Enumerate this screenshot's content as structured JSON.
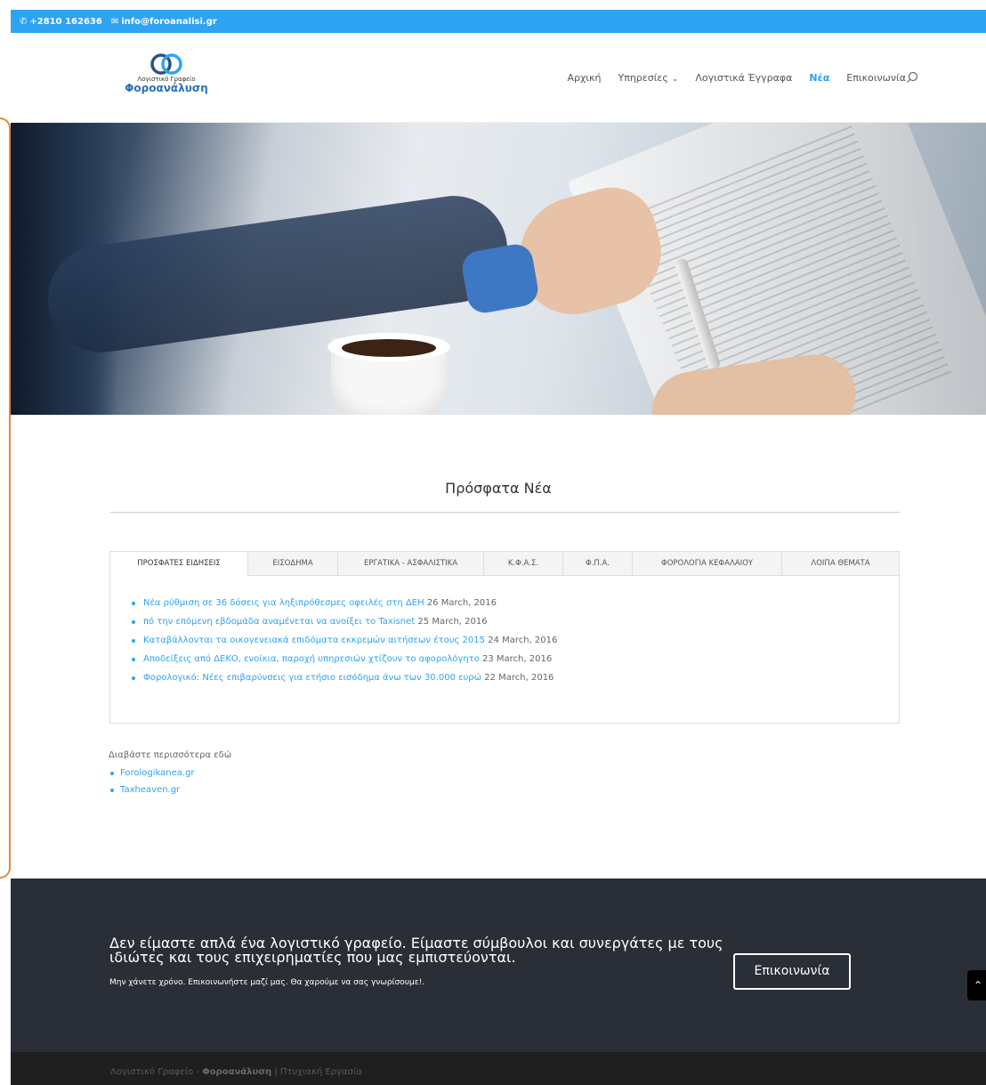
{
  "topbar": {
    "phone": "+2810 162636",
    "email": "info@foroanalisi.gr"
  },
  "logo": {
    "line1": "Λογιστικό Γραφείο",
    "line2": "Φοροανάλυση"
  },
  "nav": {
    "items": [
      {
        "label": "Αρχική"
      },
      {
        "label": "Υπηρεσίες"
      },
      {
        "label": "Λογιστικά Έγγραφα"
      },
      {
        "label": "Νέα"
      },
      {
        "label": "Επικοινωνία"
      }
    ]
  },
  "main": {
    "title": "Πρόσφατα Νέα",
    "tabs": [
      {
        "label": "ΠΡΟΣΦΑΤΕΣ ΕΙΔΗΣΕΙΣ"
      },
      {
        "label": "ΕΙΣΟΔΗΜΑ"
      },
      {
        "label": "ΕΡΓΑΤΙΚΑ - ΑΣΦΑΛΙΣΤΙΚΑ"
      },
      {
        "label": "Κ.Φ.Α.Σ."
      },
      {
        "label": "Φ.Π.Α."
      },
      {
        "label": "ΦΟΡΟΛΟΓΙΑ ΚΕΦΑΛΑΙΟΥ"
      },
      {
        "label": "ΛΟΙΠΑ ΘΕΜΑΤΑ"
      }
    ],
    "news": [
      {
        "title": "Νέα ρύθμιση σε 36 δόσεις για ληξιπρόθεσμες οφειλές στη ΔΕΗ",
        "date": "26 March, 2016"
      },
      {
        "title": "πό την επόμενη εβδομάδα αναμένεται να ανοίξει το Taxisnet",
        "date": "25 March, 2016"
      },
      {
        "title": "Καταβάλλονται τα οικογενειακά επιδόματα εκκρεμών αιτήσεων έτους 2015",
        "date": "24 March, 2016"
      },
      {
        "title": "Αποδείξεις από ΔΕΚΟ, ενοίκια, παροχή υπηρεσιών χτίζουν το αφορολόγητο",
        "date": "23 March, 2016"
      },
      {
        "title": "Φορολογικό: Νέες επιβαρύνσεις για ετήσιο εισόδημα άνω των 30.000 ευρώ",
        "date": "22 March, 2016"
      }
    ],
    "more_title": "Διαβάστε περισσότερα εδώ",
    "more_links": [
      {
        "label": "Forologikanea.gr"
      },
      {
        "label": "Taxheaven.gr"
      }
    ]
  },
  "cta": {
    "title": "Δεν είμαστε απλά ένα λογιστικό γραφείο. Είμαστε σύμβουλοι και συνεργάτες με τους ιδιώτες και τους επιχειρηματίες που μας εμπιστεύονται.",
    "subtitle": "Μην χάνετε χρόνο. Επικοινωνήστε μαζί μας. Θα χαρούμε να σας γνωρίσουμε!.",
    "button": "Επικοινωνία"
  },
  "footer": {
    "prefix": "Λογιστικό Γραφείο - ",
    "brand": "Φοροανάλυση",
    "suffix": " | Πτυχιακή Εργασία"
  },
  "colors": {
    "accent": "#2ea3f2",
    "cta_bg": "#2a2e37",
    "footer_bg": "#1f1f1f",
    "edge": "#e5883a"
  },
  "icons": {
    "phone": "phone-icon",
    "email": "envelope-icon",
    "search": "search-icon",
    "chevron": "chevron-down-icon",
    "back_to_top": "chevron-up-icon"
  }
}
